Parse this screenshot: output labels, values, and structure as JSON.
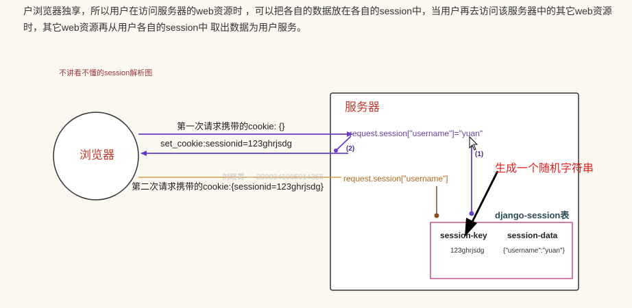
{
  "intro_text": "户浏览器独享，所以用户在访问服务器的web资源时 ，可以把各自的数据放在各自的session中，当用户再去访问该服务器中的其它web资源时，其它web资源再从用户各自的session中 取出数据为用户服务。",
  "caption": "不讲看不懂的session解析图",
  "diagram": {
    "browser_label": "浏览器",
    "server_title": "服务器",
    "first_request": "第一次请求携带的cookie:   {}",
    "set_cookie": "set_cookie:sessionid=123ghrjsdg",
    "second_request": "第二次请求携带的cookie:{sessionid=123ghrjsdg}",
    "session_set": "request.session[\"username\"]=\"yuan\"",
    "session_get": "request.session[\"username\"]",
    "step_1": "(1)",
    "step_2": "(2)",
    "random_string_note": "生成一个随机字符串",
    "table_title": "django-session表",
    "table": {
      "headers": [
        "session-key",
        "session-data"
      ],
      "rows": [
        [
          "123ghrjsdg",
          "{\"username\":\"yuan\"}"
        ]
      ]
    },
    "watermark": "刘晓菁 — 2009341095014355"
  },
  "colors": {
    "purple": "#6a3cc8",
    "orange": "#c8822a",
    "brown": "#8b4a1c",
    "red": "#e02020",
    "magenta_border": "#c0508a"
  }
}
